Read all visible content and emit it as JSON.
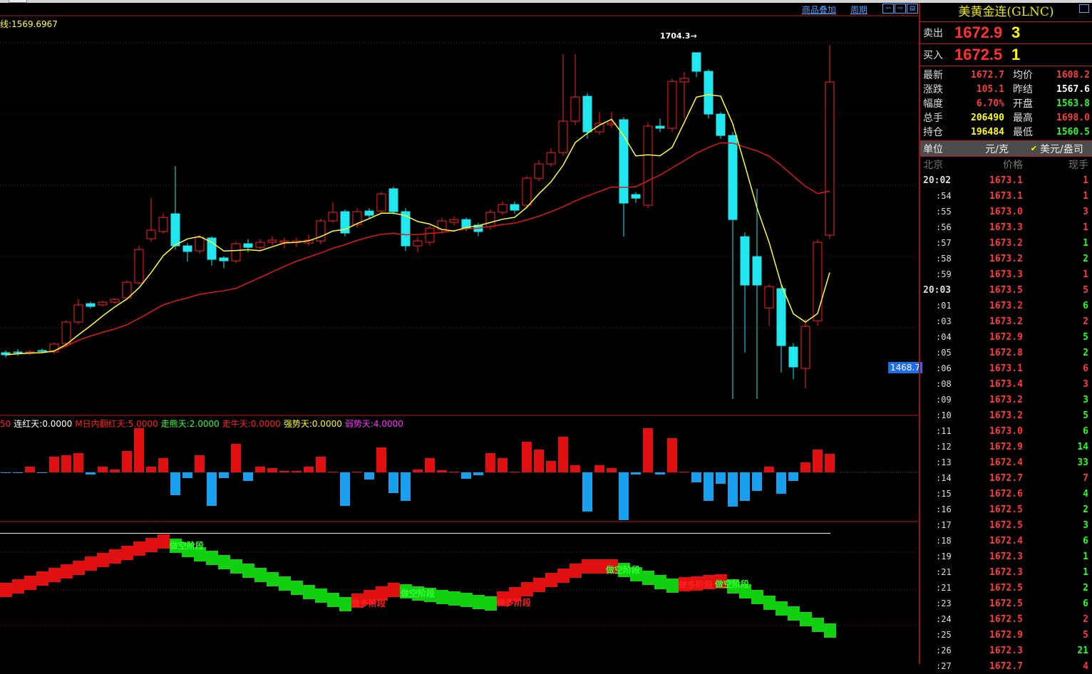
{
  "toolbar": {
    "overlay_link": "商品叠加",
    "period_link": "周期",
    "nav_left": "⇦",
    "nav_right": "⇨",
    "layout": "▤"
  },
  "main_chart": {
    "ma_label": "线:1569.6967",
    "peak_label": "1704.3→",
    "axis_tag": "1468.7"
  },
  "indicator_labels": [
    {
      "text": "50",
      "color": "#ff2020"
    },
    {
      "text": "连红天:0.0000",
      "color": "#ffffff"
    },
    {
      "text": "M日内翻红天:5.0000",
      "color": "#ff2020"
    },
    {
      "text": "走熊天:2.0000",
      "color": "#30ff30"
    },
    {
      "text": "走牛天:0.0000",
      "color": "#ff2020"
    },
    {
      "text": "强势天:0.0000",
      "color": "#ffff00"
    },
    {
      "text": "弱势天:4.0000",
      "color": "#ff30ff"
    }
  ],
  "phases": {
    "short": "做空阶段",
    "long": "做多阶段"
  },
  "panel": {
    "title": "美黄金连(GLNC)",
    "sell": {
      "label": "卖出",
      "price": "1672.9",
      "qty": "3"
    },
    "buy": {
      "label": "买入",
      "price": "1672.5",
      "qty": "1"
    },
    "stats": [
      {
        "k": "最新",
        "v": "1672.7",
        "vc": "#ff3a3a",
        "k2": "均价",
        "v2": "1608.2",
        "v2c": "#ff3a3a"
      },
      {
        "k": "涨跌",
        "v": "105.1",
        "vc": "#ff3a3a",
        "k2": "昨结",
        "v2": "1567.6",
        "v2c": "#ffffff"
      },
      {
        "k": "幅度",
        "v": "6.70%",
        "vc": "#ff3a3a",
        "k2": "开盘",
        "v2": "1563.8",
        "v2c": "#20ff20"
      },
      {
        "k": "总手",
        "v": "206490",
        "vc": "#ffff00",
        "k2": "最高",
        "v2": "1698.0",
        "v2c": "#ff3a3a"
      },
      {
        "k": "持仓",
        "v": "196484",
        "vc": "#ffff00",
        "k2": "最低",
        "v2": "1560.5",
        "v2c": "#20ff20"
      }
    ],
    "unit": {
      "label": "单位",
      "option1": "元/克",
      "check": "✔",
      "option2": "美元/盎司"
    },
    "ticks_header": {
      "time": "北京",
      "price": "价格",
      "qty": "现手"
    },
    "ticks": [
      {
        "t": "20:02",
        "p": "1673.1",
        "q": "1",
        "c": "#ff3a3a"
      },
      {
        "t": ":54",
        "p": "1673.1",
        "q": "1",
        "c": "#ff3a3a"
      },
      {
        "t": ":55",
        "p": "1673.0",
        "q": "3",
        "c": "#ff3a3a"
      },
      {
        "t": ":56",
        "p": "1673.3",
        "q": "1",
        "c": "#ff3a3a"
      },
      {
        "t": ":57",
        "p": "1673.2",
        "q": "1",
        "c": "#20ff20"
      },
      {
        "t": ":58",
        "p": "1673.2",
        "q": "2",
        "c": "#20ff20"
      },
      {
        "t": ":59",
        "p": "1673.3",
        "q": "1",
        "c": "#ff3a3a"
      },
      {
        "t": "20:03",
        "p": "1673.5",
        "q": "5",
        "c": "#ff3a3a"
      },
      {
        "t": ":01",
        "p": "1673.2",
        "q": "6",
        "c": "#20ff20"
      },
      {
        "t": ":03",
        "p": "1673.2",
        "q": "2",
        "c": "#ff3a3a"
      },
      {
        "t": ":04",
        "p": "1672.9",
        "q": "5",
        "c": "#20ff20"
      },
      {
        "t": ":05",
        "p": "1672.8",
        "q": "2",
        "c": "#20ff20"
      },
      {
        "t": ":06",
        "p": "1673.1",
        "q": "6",
        "c": "#ff3a3a"
      },
      {
        "t": ":08",
        "p": "1673.4",
        "q": "3",
        "c": "#ff3a3a"
      },
      {
        "t": ":09",
        "p": "1673.2",
        "q": "3",
        "c": "#20ff20"
      },
      {
        "t": ":10",
        "p": "1673.2",
        "q": "5",
        "c": "#20ff20"
      },
      {
        "t": ":11",
        "p": "1673.0",
        "q": "6",
        "c": "#20ff20"
      },
      {
        "t": ":12",
        "p": "1672.9",
        "q": "14",
        "c": "#20ff20"
      },
      {
        "t": ":13",
        "p": "1672.4",
        "q": "33",
        "c": "#20ff20"
      },
      {
        "t": ":14",
        "p": "1672.7",
        "q": "7",
        "c": "#ff3a3a"
      },
      {
        "t": ":15",
        "p": "1672.6",
        "q": "4",
        "c": "#20ff20"
      },
      {
        "t": ":16",
        "p": "1672.5",
        "q": "2",
        "c": "#20ff20"
      },
      {
        "t": ":17",
        "p": "1672.5",
        "q": "3",
        "c": "#20ff20"
      },
      {
        "t": ":18",
        "p": "1672.4",
        "q": "6",
        "c": "#20ff20"
      },
      {
        "t": ":19",
        "p": "1672.3",
        "q": "1",
        "c": "#20ff20"
      },
      {
        "t": ":21",
        "p": "1672.3",
        "q": "1",
        "c": "#20ff20"
      },
      {
        "t": ":21",
        "p": "1672.5",
        "q": "2",
        "c": "#20ff20"
      },
      {
        "t": ":23",
        "p": "1672.5",
        "q": "6",
        "c": "#20ff20"
      },
      {
        "t": ":24",
        "p": "1672.5",
        "q": "2",
        "c": "#ff3a3a"
      },
      {
        "t": ":25",
        "p": "1672.9",
        "q": "5",
        "c": "#ff3a3a"
      },
      {
        "t": ":26",
        "p": "1672.3",
        "q": "21",
        "c": "#20ff20"
      },
      {
        "t": ":27",
        "p": "1672.7",
        "q": "4",
        "c": "#ff3a3a"
      }
    ]
  },
  "colors": {
    "up": "#ff2020",
    "down": "#20e8f0",
    "ma_short": "#ffff30",
    "ma_long": "#e01818",
    "grid": "#801010"
  },
  "chart_data": {
    "type": "candlestick",
    "axis_reference": {
      "high": 1704.3,
      "low": 1468.7
    },
    "candles": [
      [
        1479.9,
        1478.3,
        1481.5,
        1476.3
      ],
      [
        1480.4,
        1479.9,
        1482.5,
        1477.5
      ],
      [
        1479.9,
        1480.4,
        1482.0,
        1478.0
      ],
      [
        1481.5,
        1480.9,
        1483.0,
        1479.5
      ],
      [
        1480.4,
        1486.3,
        1487.5,
        1479.0
      ],
      [
        1486.8,
        1502.8,
        1504.0,
        1485.0
      ],
      [
        1502.8,
        1515.6,
        1520.0,
        1501.0
      ],
      [
        1516.6,
        1514.5,
        1518.0,
        1513.0
      ],
      [
        1515.6,
        1517.7,
        1519.0,
        1514.5
      ],
      [
        1517.7,
        1519.8,
        1521.0,
        1516.5
      ],
      [
        1520.9,
        1532.6,
        1534.0,
        1519.5
      ],
      [
        1532.1,
        1557.1,
        1560.0,
        1531.0
      ],
      [
        1565.1,
        1571.5,
        1595.5,
        1563.0
      ],
      [
        1570.5,
        1581.1,
        1584.0,
        1569.0
      ],
      [
        1583.8,
        1559.8,
        1619.5,
        1557.0
      ],
      [
        1559.8,
        1555.6,
        1562.0,
        1548.0
      ],
      [
        1556.1,
        1566.2,
        1568.0,
        1554.0
      ],
      [
        1565.7,
        1549.7,
        1567.0,
        1545.0
      ],
      [
        1550.8,
        1548.6,
        1552.0,
        1543.0
      ],
      [
        1548.6,
        1561.4,
        1563.0,
        1547.0
      ],
      [
        1561.4,
        1558.7,
        1565.0,
        1555.0
      ],
      [
        1558.7,
        1562.5,
        1565.0,
        1557.0
      ],
      [
        1562.5,
        1564.1,
        1567.0,
        1560.0
      ],
      [
        1562.5,
        1563.5,
        1566.0,
        1558.0
      ],
      [
        1562.5,
        1563.5,
        1566.0,
        1559.0
      ],
      [
        1561.9,
        1564.1,
        1568.0,
        1560.0
      ],
      [
        1563.5,
        1578.5,
        1580.0,
        1561.0
      ],
      [
        1578.5,
        1584.9,
        1592.0,
        1577.0
      ],
      [
        1585.4,
        1569.4,
        1587.0,
        1567.0
      ],
      [
        1575.8,
        1585.4,
        1588.0,
        1573.0
      ],
      [
        1585.9,
        1582.7,
        1588.0,
        1580.0
      ],
      [
        1585.9,
        1598.7,
        1600.0,
        1584.0
      ],
      [
        1602.5,
        1585.4,
        1604.0,
        1583.0
      ],
      [
        1585.4,
        1559.8,
        1588.0,
        1556.0
      ],
      [
        1559.8,
        1563.5,
        1566.0,
        1555.0
      ],
      [
        1562.5,
        1573.1,
        1575.0,
        1560.0
      ],
      [
        1572.1,
        1578.5,
        1581.0,
        1570.0
      ],
      [
        1577.4,
        1579.5,
        1582.0,
        1575.0
      ],
      [
        1579.5,
        1573.1,
        1581.0,
        1571.0
      ],
      [
        1575.3,
        1570.5,
        1577.0,
        1567.0
      ],
      [
        1574.2,
        1584.9,
        1587.0,
        1572.0
      ],
      [
        1584.9,
        1590.7,
        1593.0,
        1583.0
      ],
      [
        1590.7,
        1586.5,
        1593.0,
        1584.0
      ],
      [
        1590.2,
        1610.4,
        1612.0,
        1588.0
      ],
      [
        1610.4,
        1621.1,
        1624.0,
        1608.0
      ],
      [
        1621.1,
        1629.6,
        1633.0,
        1619.0
      ],
      [
        1629.6,
        1653.1,
        1703.2,
        1627.0
      ],
      [
        1653.1,
        1671.2,
        1703.2,
        1650.0
      ],
      [
        1671.7,
        1645.1,
        1674.0,
        1640.0
      ],
      [
        1645.1,
        1651.5,
        1660.0,
        1643.0
      ],
      [
        1650.4,
        1651.5,
        1660.0,
        1648.0
      ],
      [
        1654.2,
        1591.8,
        1656.0,
        1566.7
      ],
      [
        1598.2,
        1595.5,
        1600.0,
        1592.0
      ],
      [
        1590.2,
        1649.4,
        1652.0,
        1588.0
      ],
      [
        1649.4,
        1647.8,
        1655.0,
        1645.0
      ],
      [
        1647.8,
        1682.9,
        1685.0,
        1645.0
      ],
      [
        1682.4,
        1685.1,
        1690.0,
        1655.0
      ],
      [
        1704.3,
        1690.4,
        1704.3,
        1686.0
      ],
      [
        1690.4,
        1658.4,
        1692.0,
        1655.0
      ],
      [
        1658.4,
        1642.4,
        1660.0,
        1640.0
      ],
      [
        1642.4,
        1579.5,
        1645.0,
        1445.2
      ],
      [
        1566.7,
        1530.5,
        1570.0,
        1480.0
      ],
      [
        1551.8,
        1530.5,
        1602.5,
        1445.2
      ],
      [
        1513.4,
        1529.4,
        1531.0,
        1500.0
      ],
      [
        1527.8,
        1485.2,
        1530.0,
        1465.0
      ],
      [
        1484.1,
        1469.2,
        1487.0,
        1460.0
      ],
      [
        1468.1,
        1499.6,
        1505.0,
        1453.2
      ],
      [
        1503.8,
        1562.5,
        1565.0,
        1500.0
      ],
      [
        1567.8,
        1682.4,
        1710.1,
        1565.0
      ]
    ],
    "indicator_values": [
      -1,
      -1,
      8,
      -1,
      22,
      24,
      27,
      -3,
      8,
      4,
      30,
      62,
      8,
      20,
      -32,
      -8,
      24,
      -47,
      -8,
      40,
      -12,
      8,
      6,
      2,
      2,
      8,
      22,
      1,
      -47,
      1,
      -10,
      35,
      -29,
      -40,
      4,
      20,
      3,
      1,
      -9,
      -4,
      27,
      20,
      1,
      43,
      32,
      16,
      50,
      10,
      -55,
      10,
      6,
      -67,
      -3,
      62,
      -3,
      48,
      1,
      -14,
      -40,
      -16,
      -48,
      -40,
      -26,
      8,
      -30,
      -12,
      14,
      32,
      26
    ],
    "band_values": [
      72,
      77,
      82,
      88,
      93,
      98,
      103,
      109,
      114,
      119,
      124,
      130,
      135,
      140,
      134,
      128,
      122,
      117,
      111,
      105,
      99,
      93,
      87,
      81,
      75,
      69,
      64,
      58,
      52,
      57,
      62,
      67,
      72,
      70,
      67,
      65,
      62,
      60,
      58,
      55,
      53,
      60,
      66,
      73,
      79,
      86,
      92,
      99,
      105,
      105,
      105,
      100,
      94,
      89,
      83,
      78,
      80,
      81,
      83,
      84,
      77,
      70,
      62,
      54,
      46,
      39,
      31,
      23,
      15
    ]
  }
}
